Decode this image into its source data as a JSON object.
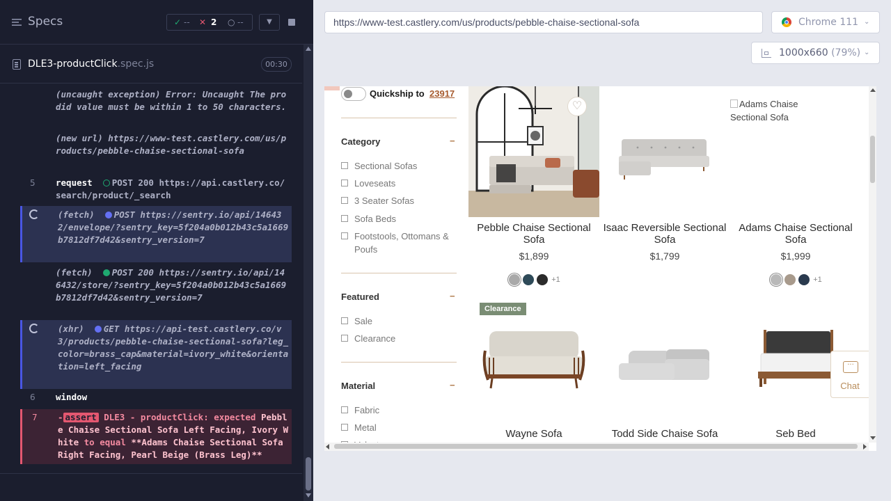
{
  "reporter": {
    "title": "Specs",
    "stats": {
      "passed": "--",
      "failed": "2",
      "pending": "--"
    },
    "spec": {
      "name": "DLE3-productClick",
      "ext": ".spec.js",
      "duration": "00:30"
    },
    "log": [
      {
        "lines": "(uncaught exception)  Error: Uncaught The prodid value must be within 1 to 50 characters."
      },
      {
        "lines": "(new url)  https://www-test.castlery.com/us/products/pebble-chaise-sectional-sofa"
      },
      {
        "num": "5",
        "cmd": "request",
        "method": "POST 200",
        "url": "https://api.castlery.co/search/product/_search"
      },
      {
        "prefix": "(fetch)",
        "method": "POST",
        "url": "https://sentry.io/api/146432/envelope/?sentry_key=5f204a0b012b43c5a1669b7812df7d42&sentry_version=7"
      },
      {
        "prefix": "(fetch)",
        "method": "POST 200",
        "url": "https://sentry.io/api/146432/store/?sentry_key=5f204a0b012b43c5a1669b7812df7d42&sentry_version=7"
      },
      {
        "prefix": "(xhr)",
        "method": "GET",
        "url": "https://api-test.castlery.co/v3/products/pebble-chaise-sectional-sofa?leg_color=brass_cap&material=ivory_white&orientation=left_facing"
      },
      {
        "num": "6",
        "cmd": "window"
      },
      {
        "num": "7",
        "badge": "assert",
        "text_a": "DLE3 - productClick: expected ",
        "hl_a": "Pebble Chaise Sectional Sofa Left Facing, Ivory White",
        "text_b": " to equal ",
        "hl_b": "**Adams Chaise Sectional Sofa Right Facing, Pearl Beige (Brass Leg)**"
      }
    ]
  },
  "aut": {
    "url": "https://www-test.castlery.com/us/products/pebble-chaise-sectional-sofa",
    "browser": "Chrome 111",
    "viewport": "1000x660",
    "zoom": "(79%)"
  },
  "page": {
    "quickship_label": "Quickship to",
    "quickship_zip": "23917",
    "filters": {
      "category": {
        "title": "Category",
        "toggle": "−",
        "options": [
          "Sectional Sofas",
          "Loveseats",
          "3 Seater Sofas",
          "Sofa Beds",
          "Footstools, Ottomans & Poufs"
        ]
      },
      "featured": {
        "title": "Featured",
        "toggle": "−",
        "options": [
          "Sale",
          "Clearance"
        ]
      },
      "material": {
        "title": "Material",
        "toggle": "−",
        "options": [
          "Fabric",
          "Metal",
          "Velvet"
        ]
      }
    },
    "products": [
      {
        "name": "Pebble Chaise Sectional Sofa",
        "price": "$1,899",
        "swatches": [
          "#a9a9a9",
          "#2e4a58",
          "#2b2b2b"
        ],
        "more": "+1"
      },
      {
        "name": "Isaac Reversible Sectional Sofa",
        "price": "$1,799"
      },
      {
        "name": "Adams Chaise Sectional Sofa",
        "price": "$1,999",
        "img_alt": "Adams Chaise Sectional Sofa",
        "swatches": [
          "#b9b9b9",
          "#a89a8c",
          "#2a3a4e"
        ],
        "more": "+1"
      },
      {
        "name": "Wayne Sofa",
        "badge": "Clearance"
      },
      {
        "name": "Todd Side Chaise Sofa"
      },
      {
        "name": "Seb Bed"
      }
    ],
    "chat_label": "Chat"
  }
}
